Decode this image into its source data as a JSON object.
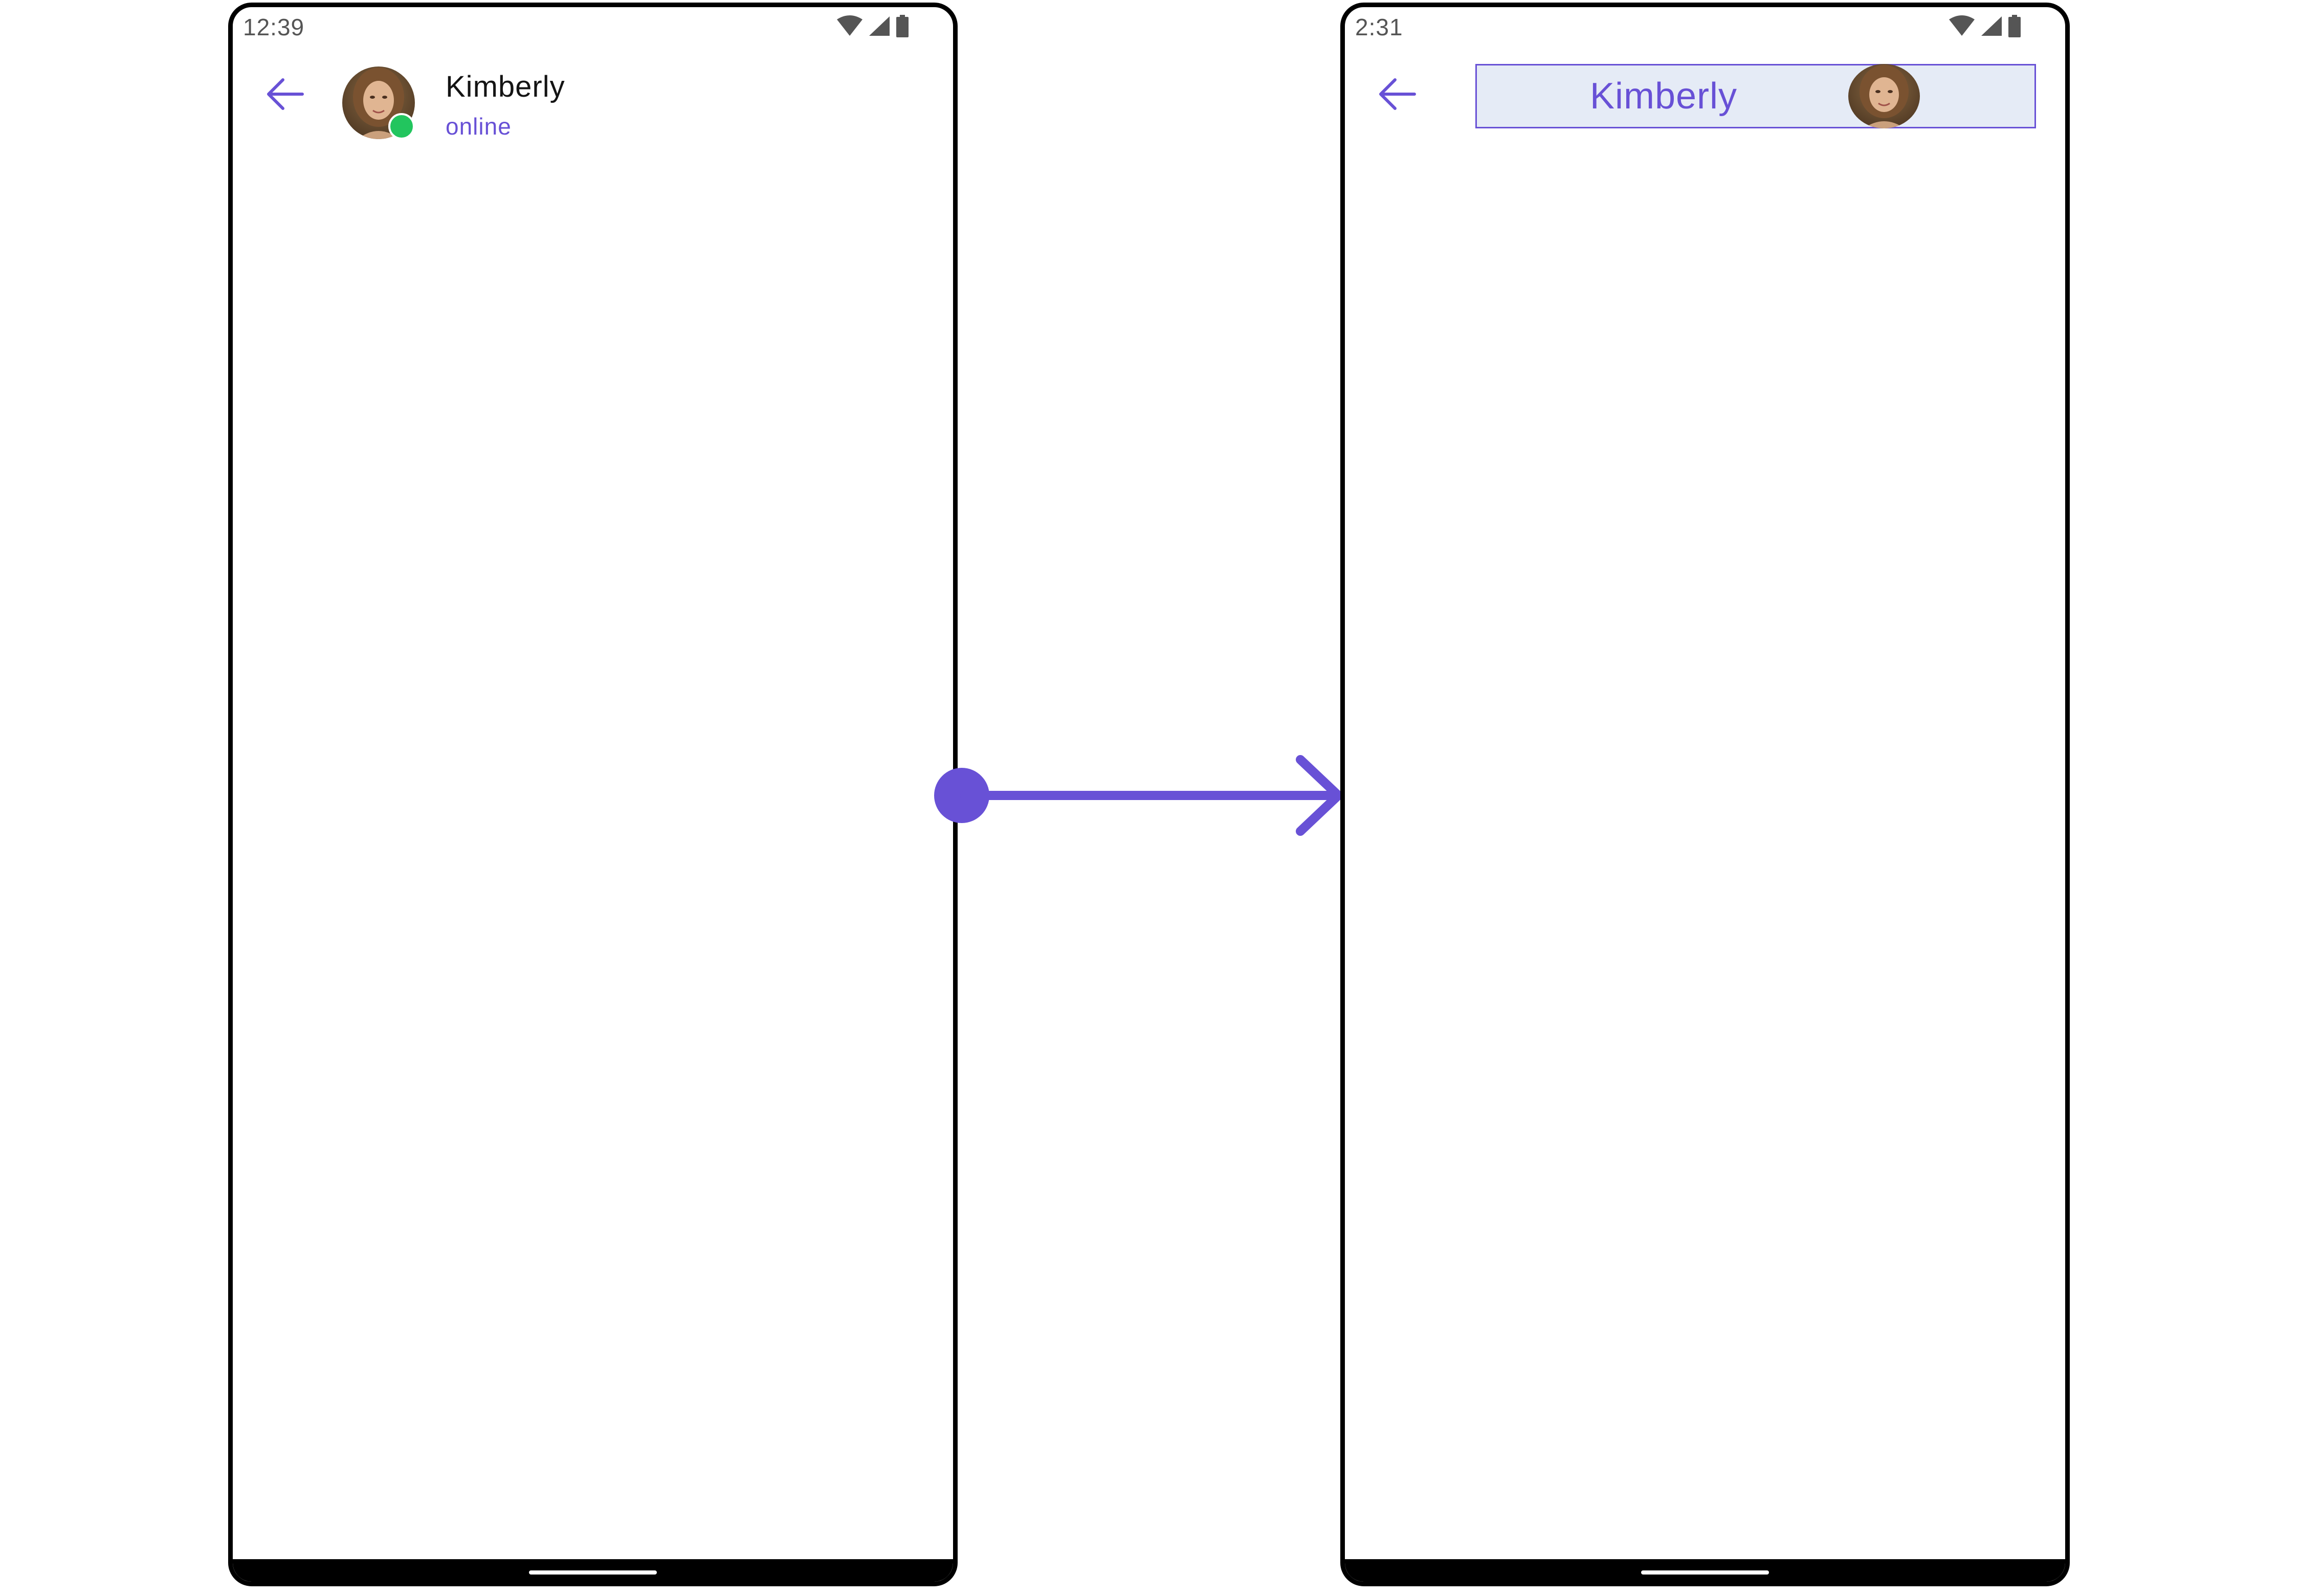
{
  "left_screen": {
    "status_time": "12:39",
    "contact_name": "Kimberly",
    "contact_status": "online"
  },
  "right_screen": {
    "status_time": "2:31",
    "contact_name": "Kimberly"
  },
  "colors": {
    "accent": "#6851d6",
    "presence_online": "#22c55e",
    "custom_header_background": "#e5ebf6",
    "frame": "#000000"
  },
  "icons": {
    "back": "arrow-left-icon",
    "wifi": "wifi-icon",
    "cellular": "cellular-signal-icon",
    "battery": "battery-icon",
    "connector": "right-arrow-connector"
  }
}
